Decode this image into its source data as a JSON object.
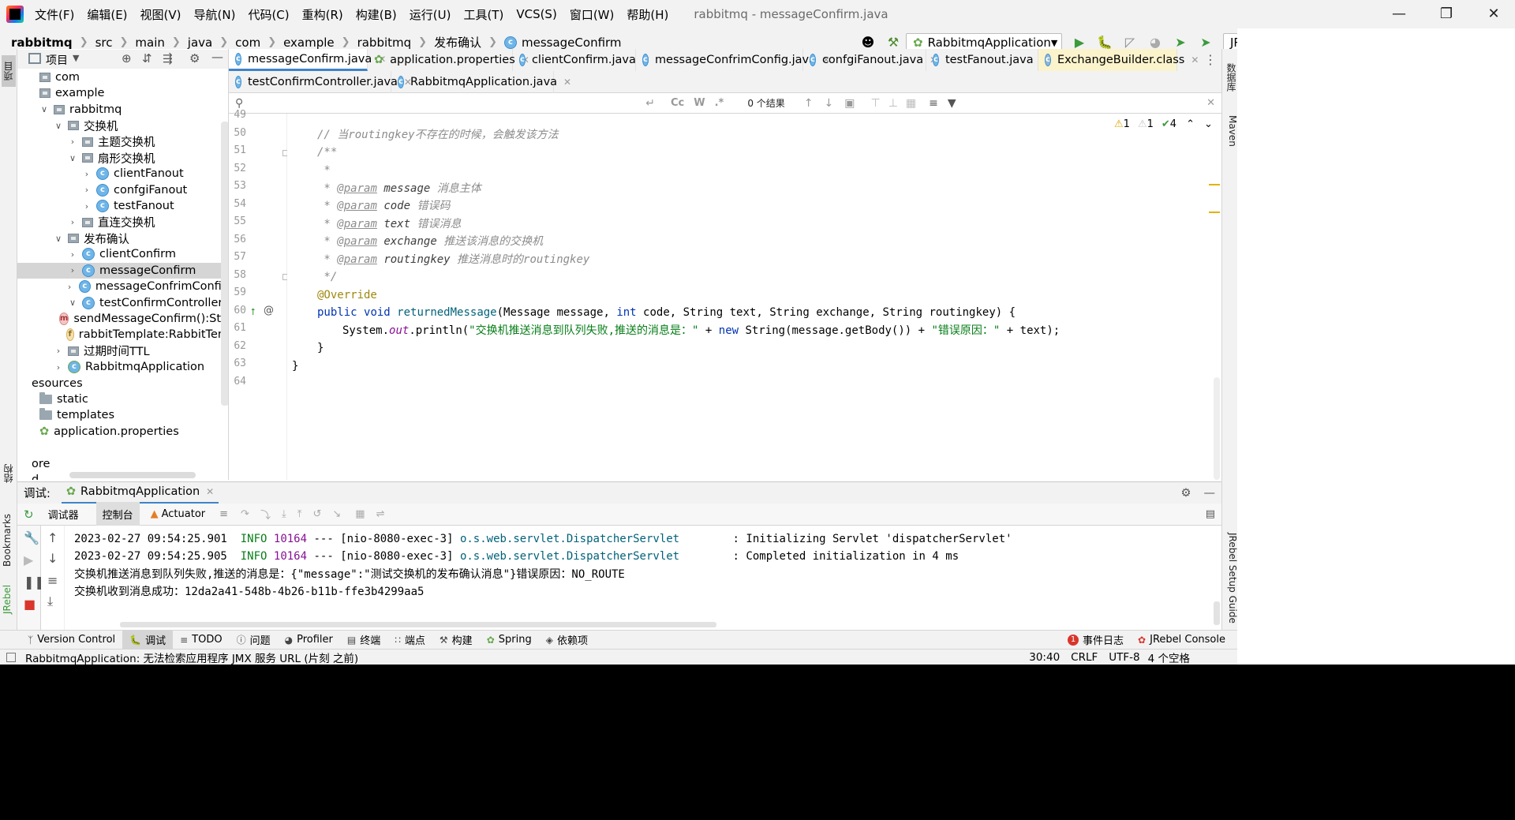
{
  "window": {
    "menus": [
      "文件(F)",
      "编辑(E)",
      "视图(V)",
      "导航(N)",
      "代码(C)",
      "重构(R)",
      "构建(B)",
      "运行(U)",
      "工具(T)",
      "VCS(S)",
      "窗口(W)",
      "帮助(H)"
    ],
    "title": "rabbitmq - messageConfirm.java"
  },
  "breadcrumb": [
    "rabbitmq",
    "src",
    "main",
    "java",
    "com",
    "example",
    "rabbitmq",
    "发布确认",
    "messageConfirm"
  ],
  "toolbar": {
    "run_config": "RabbitmqApplication",
    "jrebel_combo": "JRebel"
  },
  "left_strip": {
    "project_tab": "项目",
    "structure_tab": "结构",
    "bookmarks_tab": "Bookmarks",
    "jrebel_tab": "JRebel"
  },
  "right_strip": {
    "database_tab": "数据库",
    "maven_tab": "Maven",
    "jrebel_guide_tab": "JRebel Setup Guide"
  },
  "project": {
    "header": "项目",
    "tree": [
      {
        "label": "com",
        "icon": "package",
        "chev": ""
      },
      {
        "label": "example",
        "icon": "package",
        "chev": ""
      },
      {
        "label": "rabbitmq",
        "icon": "package",
        "chev": "v"
      },
      {
        "label": "交换机",
        "icon": "package",
        "chev": "v"
      },
      {
        "label": "主题交换机",
        "icon": "package",
        "chev": ">"
      },
      {
        "label": "扇形交换机",
        "icon": "package",
        "chev": "v"
      },
      {
        "label": "clientFanout",
        "icon": "class",
        "chev": ">"
      },
      {
        "label": "confgiFanout",
        "icon": "class",
        "chev": ">"
      },
      {
        "label": "testFanout",
        "icon": "class",
        "chev": ">"
      },
      {
        "label": "直连交换机",
        "icon": "package",
        "chev": ">"
      },
      {
        "label": "发布确认",
        "icon": "package",
        "chev": "v"
      },
      {
        "label": "clientConfirm",
        "icon": "class",
        "chev": ">"
      },
      {
        "label": "messageConfirm",
        "icon": "class",
        "chev": ">"
      },
      {
        "label": "messageConfrimConfig",
        "icon": "class",
        "chev": ">"
      },
      {
        "label": "testConfirmController",
        "icon": "class",
        "chev": "v"
      },
      {
        "label": "sendMessageConfirm():Stri",
        "icon": "method",
        "chev": ""
      },
      {
        "label": "rabbitTemplate:RabbitTem",
        "icon": "field",
        "chev": ""
      },
      {
        "label": "过期时间TTL",
        "icon": "package",
        "chev": ">"
      },
      {
        "label": "RabbitmqApplication",
        "icon": "springclass",
        "chev": ">"
      },
      {
        "label": "esources",
        "icon": "none",
        "chev": ""
      },
      {
        "label": "static",
        "icon": "folder",
        "chev": ""
      },
      {
        "label": "templates",
        "icon": "folder",
        "chev": ""
      },
      {
        "label": "application.properties",
        "icon": "props",
        "chev": ""
      },
      {
        "label": "",
        "icon": "none",
        "chev": ""
      },
      {
        "label": "ore",
        "icon": "none",
        "chev": ""
      },
      {
        "label": "d",
        "icon": "none",
        "chev": ""
      }
    ]
  },
  "editor_tabs_row1": [
    "messageConfirm.java",
    "application.properties",
    "clientConfirm.java",
    "messageConfrimConfig.java",
    "confgiFanout.java",
    "testFanout.java",
    "ExchangeBuilder.class"
  ],
  "editor_tabs_row2": [
    "testConfirmController.java",
    "RabbitmqApplication.java"
  ],
  "find": {
    "result": "0 个结果",
    "cc": "Cc",
    "w": "W",
    "regex": ".*"
  },
  "inspection": {
    "warn1": "1",
    "warn2": "1",
    "ok": "4"
  },
  "code": {
    "line_numbers": [
      "49",
      "50",
      "51",
      "52",
      "53",
      "54",
      "55",
      "56",
      "57",
      "58",
      "59",
      "60",
      "61",
      "62",
      "63",
      "64"
    ],
    "l50_cm": "// 当routingkey不存在的时候，会触发该方法",
    "l51": "/**",
    "l52": " *",
    "l53_tag": "@param",
    "l53_name": "message",
    "l53_desc": "消息主体",
    "l54_tag": "@param",
    "l54_name": "code",
    "l54_desc": "错误码",
    "l55_tag": "@param",
    "l55_name": "text",
    "l55_desc": "错误消息",
    "l56_tag": "@param",
    "l56_name": "exchange",
    "l56_desc": "推送该消息的交换机",
    "l57_tag": "@param",
    "l57_name": "routingkey",
    "l57_desc": "推送消息时的routingkey",
    "l58": " */",
    "l59_ann": "@Override",
    "l60_public": "public",
    "l60_void": "void",
    "l60_method": "returnedMessage",
    "l60_p1": "(Message message, ",
    "l60_int": "int",
    "l60_p2": " code, String text, String exchange, String routingkey) {",
    "l61_a": "System.",
    "l61_out": "out",
    "l61_b": ".println(",
    "l61_str1": "\"交换机推送消息到队列失败,推送的消息是：\"",
    "l61_c": " + ",
    "l61_new": "new",
    "l61_d": " String(message.getBody()) + ",
    "l61_str2": "\"错误原因：\"",
    "l61_e": " + text);",
    "l62": "}",
    "l63": "}"
  },
  "debug": {
    "label": "调试:",
    "session_tab": "RabbitmqApplication",
    "tabs": [
      "调试器",
      "控制台",
      "Actuator"
    ]
  },
  "console": {
    "lines": [
      {
        "ts": "2023-02-27 09:54:25.901",
        "level": "INFO",
        "pid": "10164",
        "sep": "---",
        "thread": "[nio-8080-exec-3]",
        "logger": "o.s.web.servlet.DispatcherServlet",
        "msg": ": Initializing Servlet 'dispatcherServlet'"
      },
      {
        "ts": "2023-02-27 09:54:25.905",
        "level": "INFO",
        "pid": "10164",
        "sep": "---",
        "thread": "[nio-8080-exec-3]",
        "logger": "o.s.web.servlet.DispatcherServlet",
        "msg": ": Completed initialization in 4 ms"
      }
    ],
    "out1": "交换机推送消息到队列失败,推送的消息是：{\"message\":\"测试交换机的发布确认消息\"}错误原因：NO_ROUTE",
    "out2": "交换机收到消息成功：12da2a41-548b-4b26-b11b-ffe3b4299aa5"
  },
  "bottom_tabs": [
    "Version Control",
    "调试",
    "TODO",
    "问题",
    "Profiler",
    "终端",
    "端点",
    "构建",
    "Spring",
    "依赖项"
  ],
  "bottom_right": {
    "events": "事件日志",
    "events_count": "1",
    "jrebel_console": "JRebel Console"
  },
  "status": {
    "message": "RabbitmqApplication: 无法检索应用程序 JMX 服务 URL (片刻 之前)",
    "position": "30:40",
    "line_sep": "CRLF",
    "encoding": "UTF-8",
    "indent": "4 个空格"
  }
}
